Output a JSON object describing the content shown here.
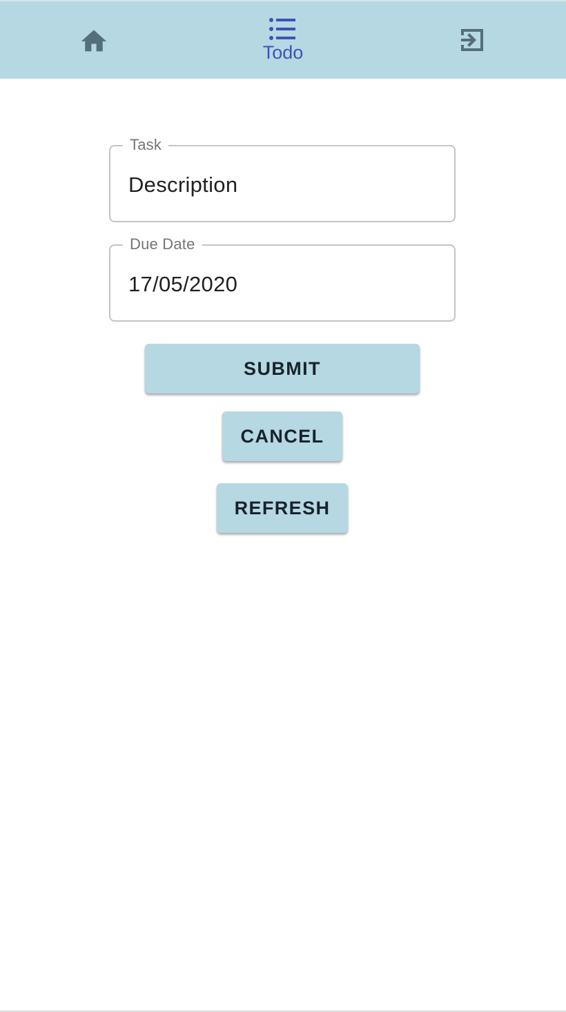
{
  "nav": {
    "home": {
      "icon": "home-icon"
    },
    "todo": {
      "icon": "list-icon",
      "label": "Todo",
      "active": true
    },
    "logout": {
      "icon": "exit-to-app-icon"
    }
  },
  "form": {
    "task": {
      "label": "Task",
      "value": "Description"
    },
    "due_date": {
      "label": "Due Date",
      "value": "17/05/2020"
    }
  },
  "buttons": {
    "submit": "SUBMIT",
    "cancel": "CANCEL",
    "refresh": "REFRESH"
  },
  "colors": {
    "accent": "#b5d8e3",
    "active_nav": "#3f51b5",
    "icon_inactive": "#546e7a"
  }
}
